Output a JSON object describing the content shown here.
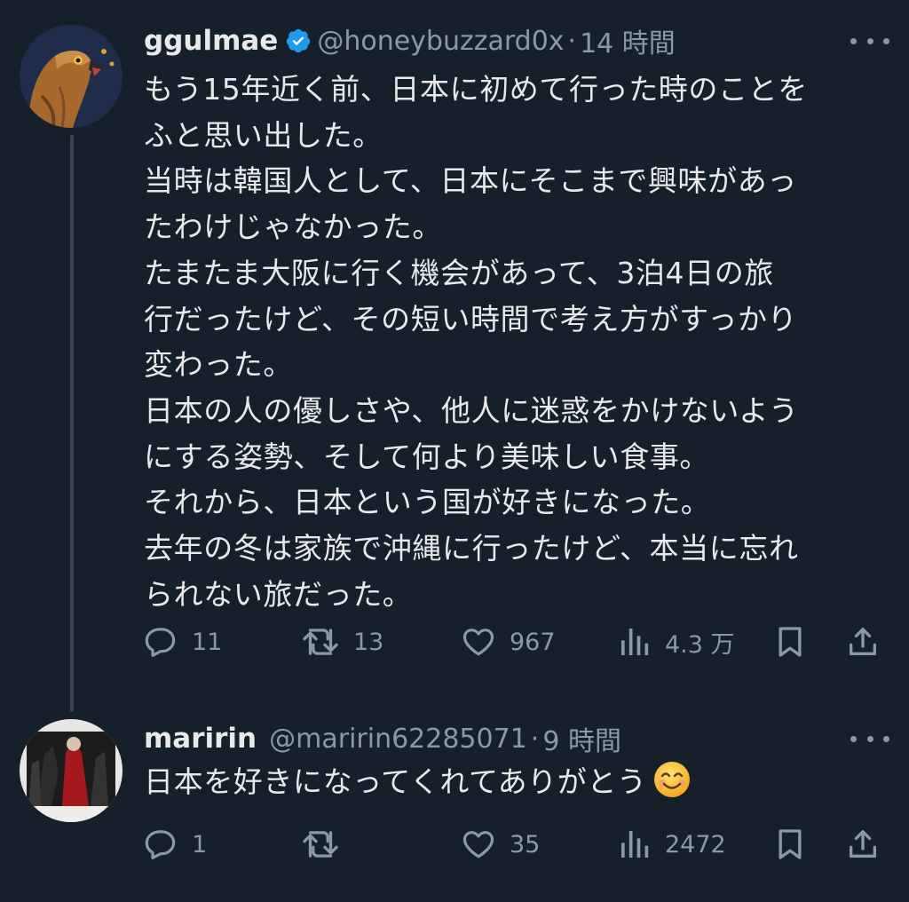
{
  "tweet": {
    "display_name": "ggulmae",
    "handle": "@honeybuzzard0x",
    "separator": "·",
    "time": "14 時間",
    "verified": true,
    "lines": [
      "もう15年近く前、日本に初めて行った時のことを",
      "ふと思い出した。",
      "当時は韓国人として、日本にそこまで興味があっ",
      "たわけじゃなかった。",
      "たまたま大阪に行く機会があって、3泊4日の旅",
      "行だったけど、その短い時間で考え方がすっかり",
      "変わった。",
      "日本の人の優しさや、他人に迷惑をかけないよう",
      "にする姿勢、そして何より美味しい食事。",
      "それから、日本という国が好きになった。",
      "去年の冬は家族で沖縄に行ったけど、本当に忘れ",
      "られない旅だった。"
    ],
    "stats": {
      "replies": "11",
      "retweets": "13",
      "likes": "967",
      "views": "4.3 万"
    }
  },
  "reply": {
    "display_name": "maririn",
    "handle": "@maririn62285071",
    "separator": "·",
    "time": "9 時間",
    "text": "日本を好きになってくれてありがとう",
    "emoji": "smiling-face-icon",
    "stats": {
      "replies": "1",
      "retweets": "",
      "likes": "35",
      "views": "2472"
    }
  },
  "colors": {
    "background": "#15202b",
    "text": "#e7e9ea",
    "secondary": "#8b98a5",
    "verified": "#1d9bf0",
    "thread_line": "#38444d"
  },
  "icons": [
    "reply-icon",
    "retweet-icon",
    "like-icon",
    "views-icon",
    "bookmark-icon",
    "share-icon",
    "more-icon",
    "verified-icon"
  ]
}
